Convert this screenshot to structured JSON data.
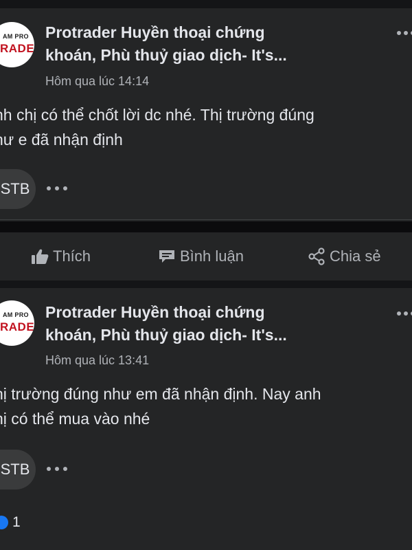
{
  "posts": [
    {
      "author": [
        "Protrader Huyền thoại chứng",
        "khoán, Phù thuỷ giao dịch- It's..."
      ],
      "avatar": {
        "top_text": "AM PRO",
        "bottom_text": "RADER"
      },
      "time": "Hôm qua lúc 14:14",
      "body": [
        "nh chị có thể chốt lời dc nhé. Thị trường đúng",
        "hư e đã nhận định"
      ],
      "tag": "STB"
    },
    {
      "author": [
        "Protrader Huyền thoại chứng",
        "khoán, Phù thuỷ giao dịch- It's..."
      ],
      "avatar": {
        "top_text": "AM PRO",
        "bottom_text": "RADER"
      },
      "time": "Hôm qua lúc 13:41",
      "body": [
        "hị trường đúng như em đã nhận định. Nay anh",
        "hị có thể mua vào nhé"
      ],
      "tag": "STB"
    }
  ],
  "actions": {
    "like": "Thích",
    "comment": "Bình luận",
    "share": "Chia sẻ"
  },
  "reactions": {
    "like_count": "1"
  },
  "colors": {
    "background": "#0b0b0d",
    "card": "#242526",
    "text": "#e4e6eb",
    "muted": "#b0b3b8",
    "brand_red": "#c1121f",
    "like_blue": "#1877f2"
  },
  "icons": [
    "thumbs-up-icon",
    "comment-icon",
    "share-icon",
    "more-dots-icon"
  ]
}
